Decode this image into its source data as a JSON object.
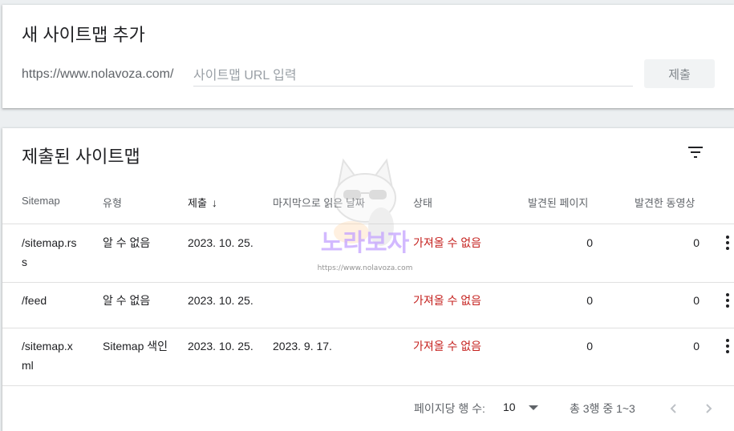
{
  "add_card": {
    "title": "새 사이트맵 추가",
    "url_prefix": "https://www.nolavoza.com/",
    "input_placeholder": "사이트맵 URL 입력",
    "input_value": "",
    "submit_label": "제출"
  },
  "list_card": {
    "title": "제출된 사이트맵",
    "columns": {
      "sitemap": "Sitemap",
      "type": "유형",
      "submitted": "제출",
      "last_read": "마지막으로 읽은 날짜",
      "status": "상태",
      "pages": "발견된 페이지",
      "videos": "발견한 동영상"
    },
    "rows": [
      {
        "sitemap_l1": "/sitemap.rs",
        "sitemap_l2": "s",
        "type": "알 수 없음",
        "submitted": "2023. 10. 25.",
        "last_read": "",
        "status": "가져올 수 없음",
        "pages": "0",
        "videos": "0"
      },
      {
        "sitemap_l1": "/feed",
        "sitemap_l2": "",
        "type": "알 수 없음",
        "submitted": "2023. 10. 25.",
        "last_read": "",
        "status": "가져올 수 없음",
        "pages": "0",
        "videos": "0"
      },
      {
        "sitemap_l1": "/sitemap.x",
        "sitemap_l2": "ml",
        "type": "Sitemap 색인",
        "submitted": "2023. 10. 25.",
        "last_read": "2023. 9. 17.",
        "status": "가져올 수 없음",
        "pages": "0",
        "videos": "0"
      }
    ],
    "footer": {
      "rows_per_page_label": "페이지당 행 수:",
      "rows_per_page_value": "10",
      "range_text": "총 3행 중 1~3"
    }
  },
  "watermark": {
    "brand": "노라보자",
    "url": "https://www.nolavoza.com"
  },
  "colors": {
    "error": "#c5221f",
    "muted": "#5f6368"
  }
}
